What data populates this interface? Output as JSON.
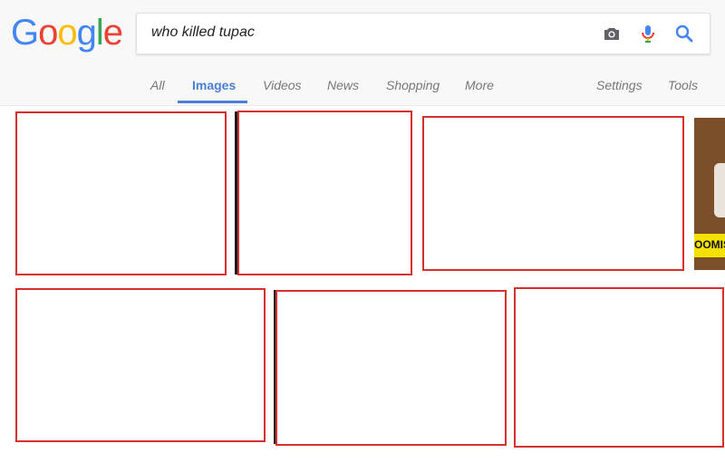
{
  "logo": {
    "letters": [
      {
        "char": "G",
        "color": "#4285F4"
      },
      {
        "char": "o",
        "color": "#EA4335"
      },
      {
        "char": "o",
        "color": "#FBBC05"
      },
      {
        "char": "g",
        "color": "#4285F4"
      },
      {
        "char": "l",
        "color": "#34A853"
      },
      {
        "char": "e",
        "color": "#EA4335"
      }
    ]
  },
  "search": {
    "query": "who killed tupac",
    "icons": [
      "camera-icon",
      "microphone-icon",
      "search-icon"
    ]
  },
  "tabs": [
    {
      "label": "All",
      "active": false
    },
    {
      "label": "Images",
      "active": true
    },
    {
      "label": "Videos",
      "active": false
    },
    {
      "label": "News",
      "active": false
    },
    {
      "label": "Shopping",
      "active": false
    },
    {
      "label": "More",
      "active": false
    },
    {
      "label": "Settings",
      "active": false
    },
    {
      "label": "Tools",
      "active": false
    }
  ],
  "results": {
    "partial_thumb_text": "OOMIS",
    "colors": {
      "accent": "#4a7fd8",
      "highlight_border": "#d72e2e",
      "banner": "#f4e100"
    }
  }
}
